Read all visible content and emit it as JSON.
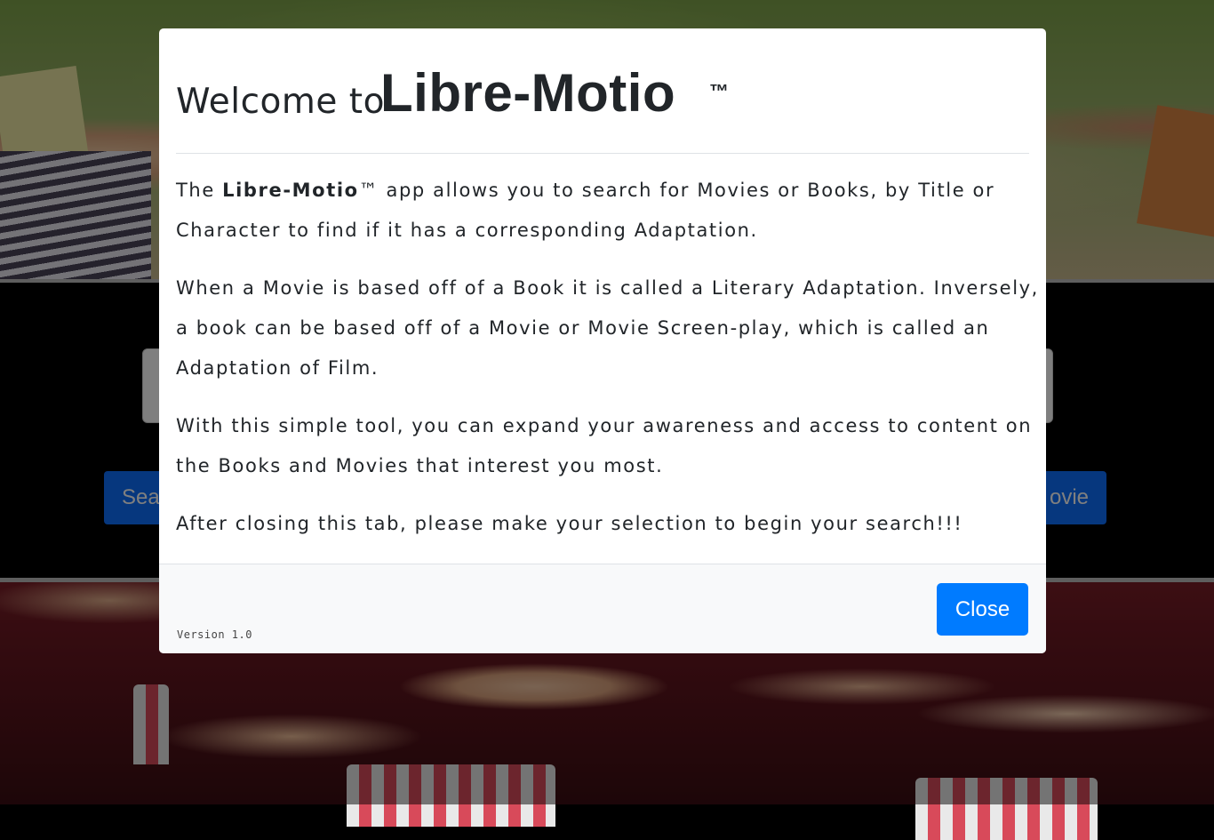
{
  "background": {
    "search_placeholder": "",
    "buttons": {
      "left_label_visible": "Sea",
      "right_label_visible": "ovie"
    }
  },
  "modal": {
    "title_prefix": "Welcome to",
    "brand": "Libre-Motio",
    "trademark": "™",
    "paragraphs": {
      "p1_lead": "The ",
      "p1_brand": "Libre-Motio",
      "p1_rest": "™ app allows you to search for Movies or Books, by Title or Character to find if it has a corresponding Adaptation.",
      "p2": "When a Movie is based off of a Book it is called a Literary Adaptation. Inversely, a book can be based off of a Movie or Movie Screen-play, which is called an Adaptation of Film.",
      "p3": "With this simple tool, you can expand your awareness and access to content on the Books and Movies that interest you most.",
      "p4": "After closing this tab, please make your selection to begin your search!!!"
    },
    "footer": {
      "version": "Version 1.0",
      "close_label": "Close"
    }
  },
  "colors": {
    "primary": "#007bff",
    "backdrop": "rgba(0,0,0,0.5)",
    "text": "#212529"
  }
}
